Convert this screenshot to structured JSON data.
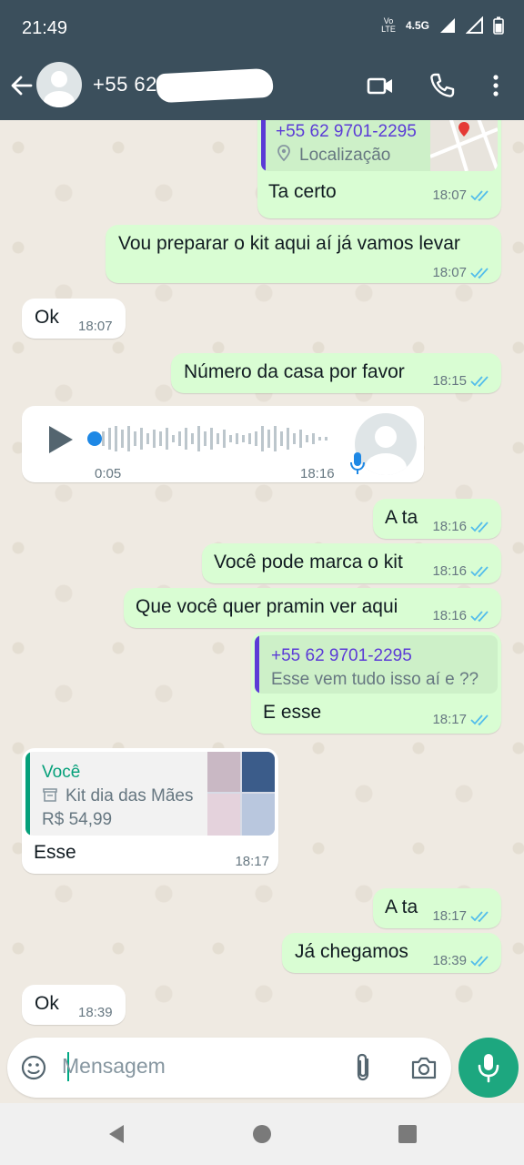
{
  "status_bar": {
    "time": "21:49",
    "volte": "Vo LTE",
    "network": "4.5G"
  },
  "header": {
    "contact_name": "+55 62"
  },
  "messages": [
    {
      "quote_name": "+55 62 9701-2295",
      "quote_text": "Localização",
      "text": "Ta certo",
      "time": "18:07"
    },
    {
      "text": "Vou preparar o kit aqui aí já vamos levar",
      "time": "18:07"
    },
    {
      "text": "Ok",
      "time": "18:07"
    },
    {
      "text": "Número da casa por favor",
      "time": "18:15"
    },
    {
      "duration": "0:05",
      "time": "18:16"
    },
    {
      "text": "A ta",
      "time": "18:16"
    },
    {
      "text": "Você pode marca o kit",
      "time": "18:16"
    },
    {
      "text": "Que você quer pramin ver aqui",
      "time": "18:16"
    },
    {
      "quote_name": "+55 62 9701-2295",
      "quote_text": "Esse vem tudo isso aí e ??",
      "text": "E esse",
      "time": "18:17"
    },
    {
      "quote_name": "Você",
      "quote_text": "Kit dia das Mães",
      "quote_price": "R$ 54,99",
      "text": "Esse",
      "time": "18:17"
    },
    {
      "text": "A ta",
      "time": "18:17"
    },
    {
      "text": "Já chegamos",
      "time": "18:39"
    },
    {
      "text": "Ok",
      "time": "18:39"
    }
  ],
  "composer": {
    "placeholder": "Mensagem"
  },
  "colors": {
    "header": "#3b4f5c",
    "outgoing": "#d9fdd3",
    "incoming": "#ffffff",
    "read_ticks": "#53bdeb",
    "accent": "#1da77f"
  }
}
